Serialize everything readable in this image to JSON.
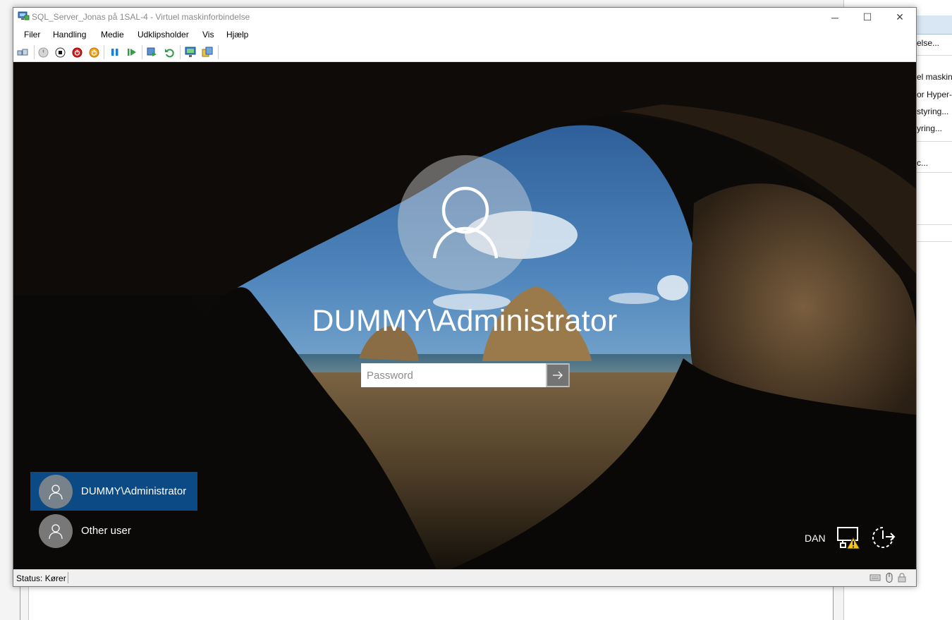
{
  "window": {
    "title": "SQL_Server_Jonas på 1SAL-4 - Virtuel maskinforbindelse",
    "controls": {
      "minimize": "─",
      "maximize": "☐",
      "close": "✕"
    }
  },
  "menu": [
    "Filer",
    "Handling",
    "Medie",
    "Udklipsholder",
    "Vis",
    "Hjælp"
  ],
  "toolbar": {
    "buttons": [
      "ctrl-alt-del-icon",
      "start-icon",
      "turn-off-icon",
      "shutdown-icon",
      "save-icon",
      "pause-icon",
      "resume-icon",
      "checkpoint-icon",
      "revert-icon",
      "enhanced-session-icon",
      "share-icon"
    ]
  },
  "login": {
    "user": "DUMMY\\Administrator",
    "password_placeholder": "Password"
  },
  "user_list": [
    {
      "label": "DUMMY\\Administrator",
      "selected": true
    },
    {
      "label": "Other user",
      "selected": false
    }
  ],
  "tray": {
    "language": "DAN",
    "icons": [
      "network-warning-icon",
      "power-icon"
    ]
  },
  "status_bar": {
    "text": "Status: Kører",
    "icons": [
      "keyboard-icon",
      "mouse-icon",
      "lock-icon"
    ]
  },
  "background_app": {
    "actions": [
      "else...",
      "el maskin",
      "or Hyper-V",
      "styring...",
      "yring...",
      "c..."
    ]
  },
  "colors": {
    "selected_tile": "#0b4a84",
    "title_text": "#8a8a8a",
    "bg_right_header": "#d9e6f3"
  }
}
